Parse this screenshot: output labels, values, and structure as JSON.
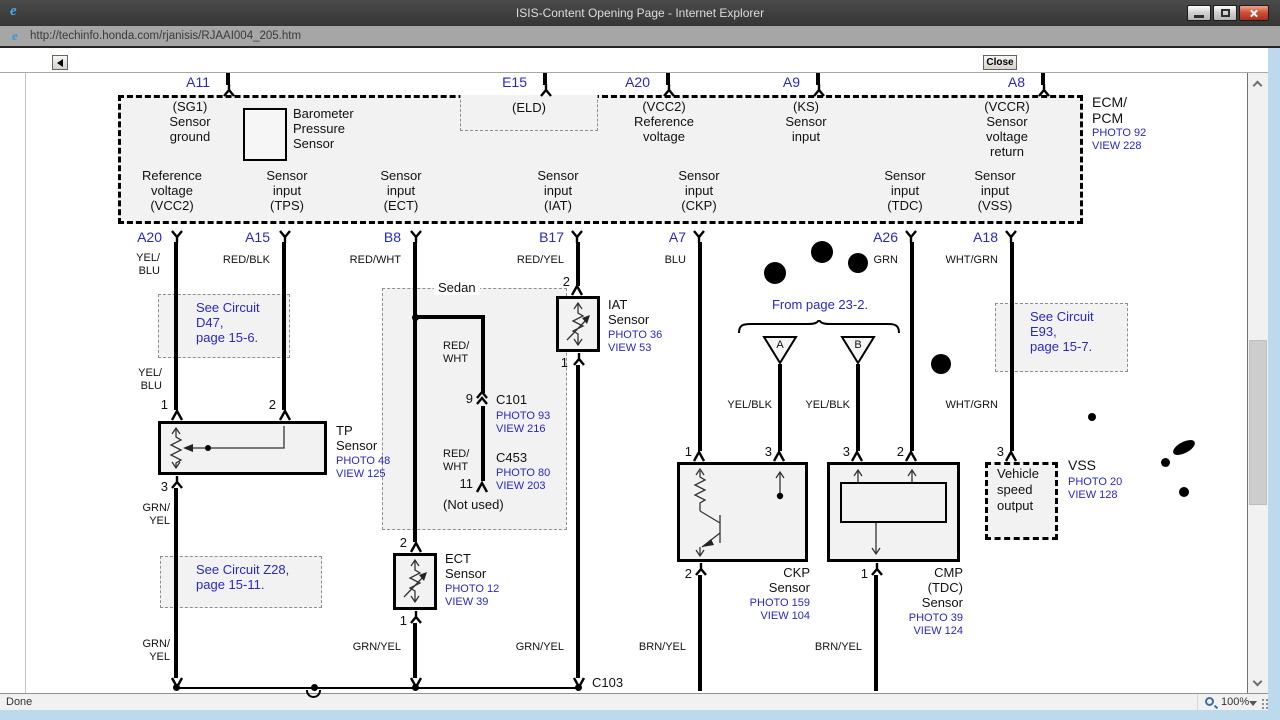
{
  "window": {
    "title": "ISIS-Content Opening Page - Internet Explorer",
    "url": "http://techinfo.honda.com/rjanisis/RJAAI004_205.htm",
    "close_label": "Close",
    "status": "Done",
    "zoom_level": "100%"
  },
  "colors": {
    "link_blue": "#2828c8",
    "titlebar_gray": "#3f3f3f",
    "frame_blue": "#bddaec",
    "box_fill": "#f2f2f2",
    "close_red": "#c0392b"
  },
  "icons": {
    "ie_logo": "e"
  },
  "diagram": {
    "ecm": {
      "name": "ECM/\nPCM",
      "photo": "PHOTO 92",
      "view": "VIEW 228"
    },
    "top_connectors": {
      "a11": "A11",
      "e15": "E15",
      "a20": "A20",
      "a9": "A9",
      "a8": "A8"
    },
    "ecm_labels": {
      "sg1": "(SG1)\nSensor\nground",
      "baro": "Barometer\nPressure\nSensor",
      "eld": "(ELD)",
      "vcc2": "(VCC2)\nReference\nvoltage",
      "ks": "(KS)\nSensor\ninput",
      "vccr": "(VCCR)\nSensor\nvoltage\nreturn",
      "ref_vcc2": "Reference\nvoltage\n(VCC2)",
      "in_tps": "Sensor\ninput\n(TPS)",
      "in_ect": "Sensor\ninput\n(ECT)",
      "in_iat": "Sensor\ninput\n(IAT)",
      "in_ckp": "Sensor\ninput\n(CKP)",
      "in_tdc": "Sensor\ninput\n(TDC)",
      "in_vss": "Sensor\ninput\n(VSS)"
    },
    "row2_connectors": {
      "a20": "A20",
      "a15": "A15",
      "b8": "B8",
      "b17": "B17",
      "a7": "A7",
      "a26": "A26",
      "a18": "A18"
    },
    "wires": {
      "yel_blu": "YEL/\nBLU",
      "red_blk": "RED/BLK",
      "red_wht": "RED/WHT",
      "red_wht_2l": "RED/\nWHT",
      "red_yel": "RED/YEL",
      "blu": "BLU",
      "grn": "GRN",
      "wht_grn": "WHT/GRN",
      "yel_blk": "YEL/BLK",
      "grn_yel": "GRN/YEL",
      "grn_yel_2l": "GRN/\nYEL",
      "brn_yel": "BRN/YEL"
    },
    "notes": {
      "d47": "See Circuit\nD47,\npage 15-6.",
      "z28": "See Circuit Z28,\npage 15-11.",
      "e93": "See Circuit\nE93,\npage 15-7.",
      "from_page": "From page 23-2.",
      "sedan": "Sedan",
      "not_used": "(Not used)"
    },
    "branches": {
      "tri_a": "A",
      "tri_b": "B"
    },
    "components": {
      "tp": {
        "name": "TP\nSensor",
        "photo": "PHOTO 48",
        "view": "VIEW 125"
      },
      "iat": {
        "name": "IAT\nSensor",
        "photo": "PHOTO 36",
        "view": "VIEW 53"
      },
      "ect": {
        "name": "ECT\nSensor",
        "photo": "PHOTO 12",
        "view": "VIEW 39"
      },
      "ckp": {
        "name": "CKP\nSensor",
        "photo": "PHOTO 159",
        "view": "VIEW 104"
      },
      "cmp": {
        "name": "CMP\n(TDC)\nSensor",
        "photo": "PHOTO 39",
        "view": "VIEW 124"
      },
      "vss": {
        "name": "VSS",
        "photo": "PHOTO 20",
        "view": "VIEW 128"
      },
      "vso": {
        "name": "Vehicle\nspeed\noutput"
      },
      "c101": {
        "name": "C101",
        "photo": "PHOTO 93",
        "view": "VIEW 216"
      },
      "c453": {
        "name": "C453",
        "photo": "PHOTO 80",
        "view": "VIEW 203"
      },
      "c103": {
        "name": "C103"
      }
    },
    "pin_numbers": {
      "p1": "1",
      "p2": "2",
      "p3": "3",
      "p9": "9",
      "p11": "11"
    }
  }
}
